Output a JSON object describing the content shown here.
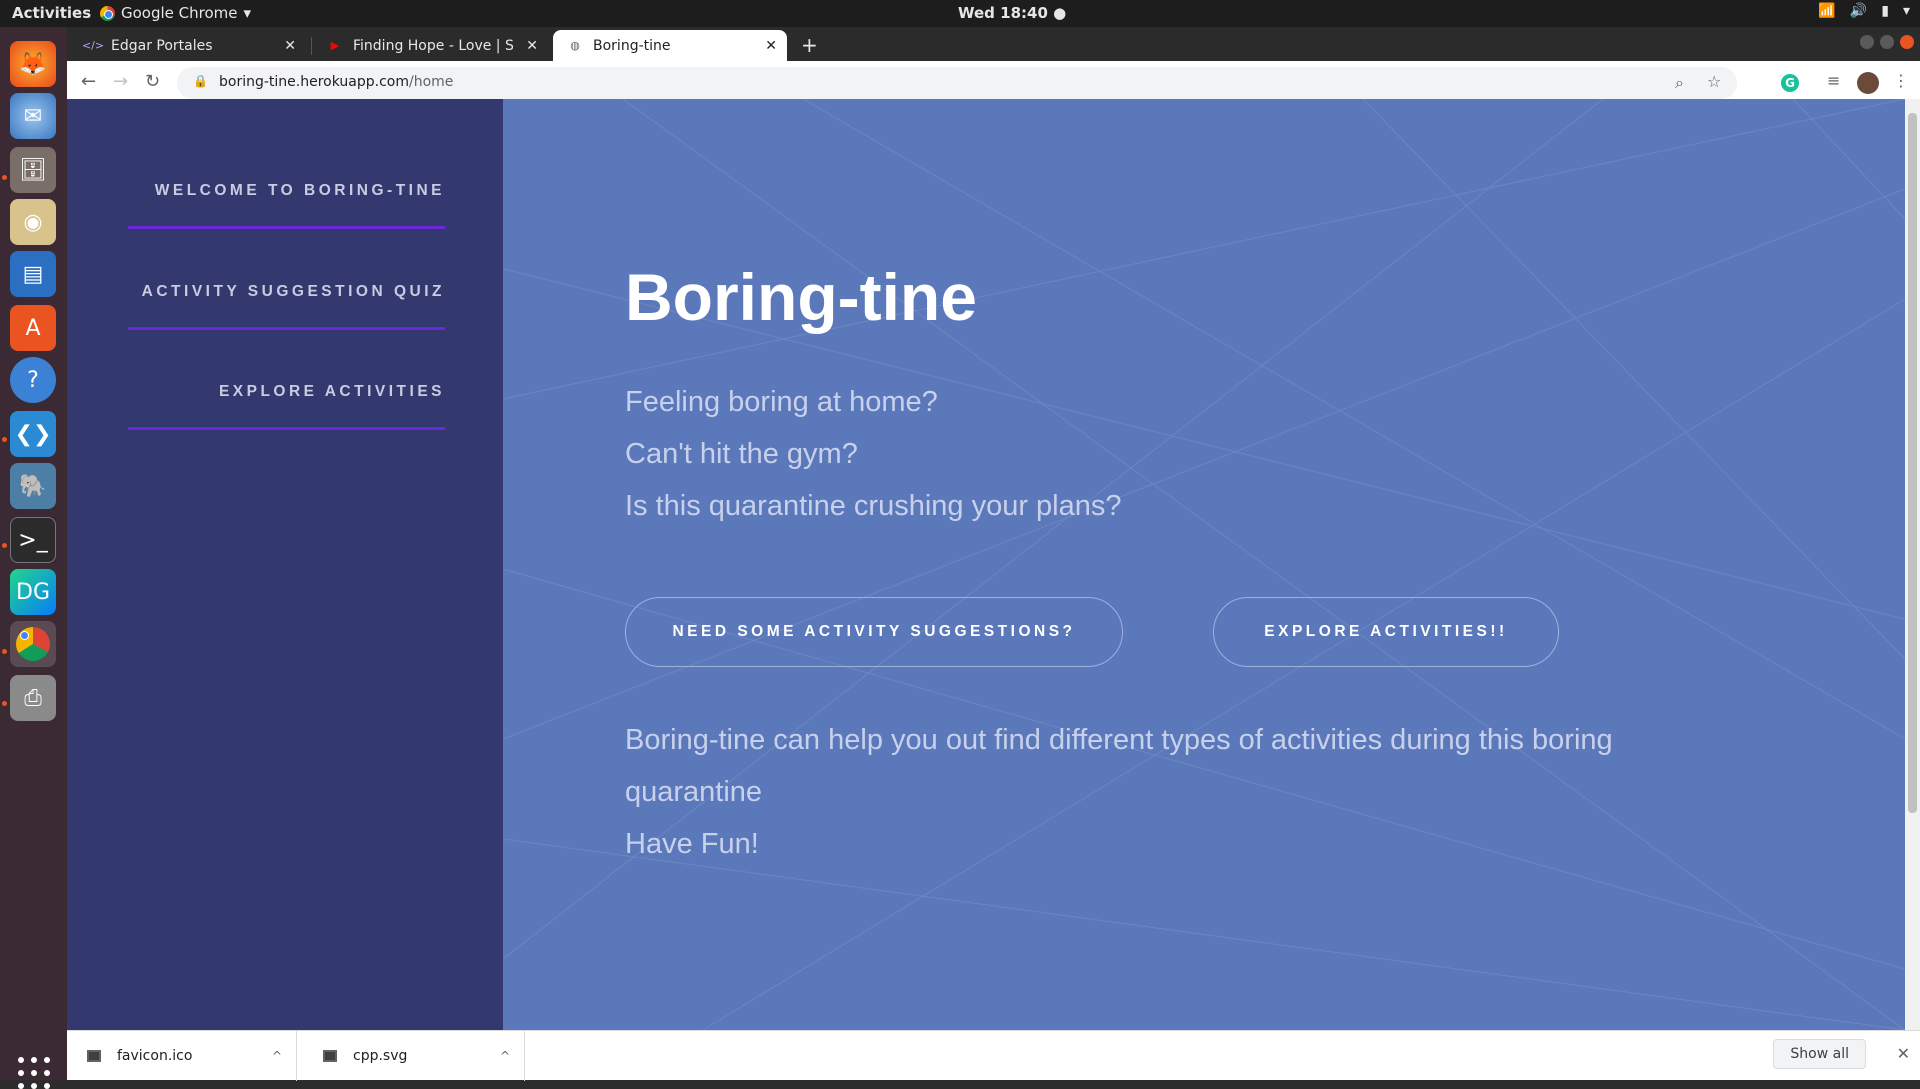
{
  "topbar": {
    "activities": "Activities",
    "app_name": "Google Chrome",
    "clock": "Wed 18:40"
  },
  "browser": {
    "tabs": [
      {
        "title": "Edgar Portales",
        "favicon": "code-icon"
      },
      {
        "title": "Finding Hope - Love | S",
        "favicon": "youtube-icon"
      },
      {
        "title": "Boring-tine",
        "favicon": "globe-icon"
      }
    ],
    "url_host": "boring-tine.herokuapp.com",
    "url_path": "/home"
  },
  "sidebar": {
    "links": [
      {
        "label": "WELCOME TO BORING-TINE"
      },
      {
        "label": "ACTIVITY SUGGESTION QUIZ"
      },
      {
        "label": "EXPLORE ACTIVITIES"
      }
    ],
    "underline_color": "#6a28d9"
  },
  "hero": {
    "title": "Boring-tine",
    "intro_lines": [
      "Feeling boring at home?",
      "Can't hit the gym?",
      "Is this quarantine crushing your plans?"
    ],
    "buttons": {
      "suggestions": "NEED SOME ACTIVITY SUGGESTIONS?",
      "explore": "EXPLORE ACTIVITIES!!"
    },
    "description_lines": [
      "Boring-tine can help you out find different types of activities during this boring",
      "quarantine",
      "Have Fun!"
    ]
  },
  "downloads": {
    "items": [
      {
        "name": "favicon.ico"
      },
      {
        "name": "cpp.svg"
      }
    ],
    "show_all": "Show all"
  },
  "colors": {
    "sidebar_bg": "#33396f",
    "main_bg": "#5b78ba",
    "dock_bg": "#3b2a33"
  }
}
